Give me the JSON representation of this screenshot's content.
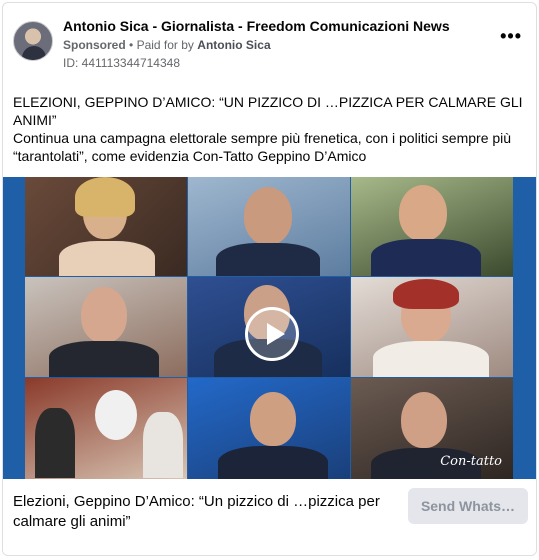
{
  "post": {
    "page_name": "Antonio Sica - Giornalista - Freedom Comunicazioni News",
    "sponsored_label": "Sponsored",
    "paid_for_prefix": "Paid for by",
    "paid_for_name": "Antonio Sica",
    "ad_id": "ID: 441113344714348",
    "more_icon": "more-dots-icon",
    "body_title": "ELEZIONI, GEPPINO D’AMICO: “UN PIZZICO DI …PIZZICA PER CALMARE GLI ANIMI”",
    "body_desc": "Continua una campagna elettorale sempre più frenetica, con i politici sempre più “tarantolati”, come evidenzia Con-Tatto Geppino D’Amico"
  },
  "media": {
    "play_icon": "play-icon",
    "watermark": "Con-tatto",
    "background_color": "#1f5fa8"
  },
  "footer": {
    "title": "Elezioni, Geppino D’Amico: “Un pizzico di …pizzica per calmare gli animi”",
    "cta_label": "Send Whats…"
  }
}
